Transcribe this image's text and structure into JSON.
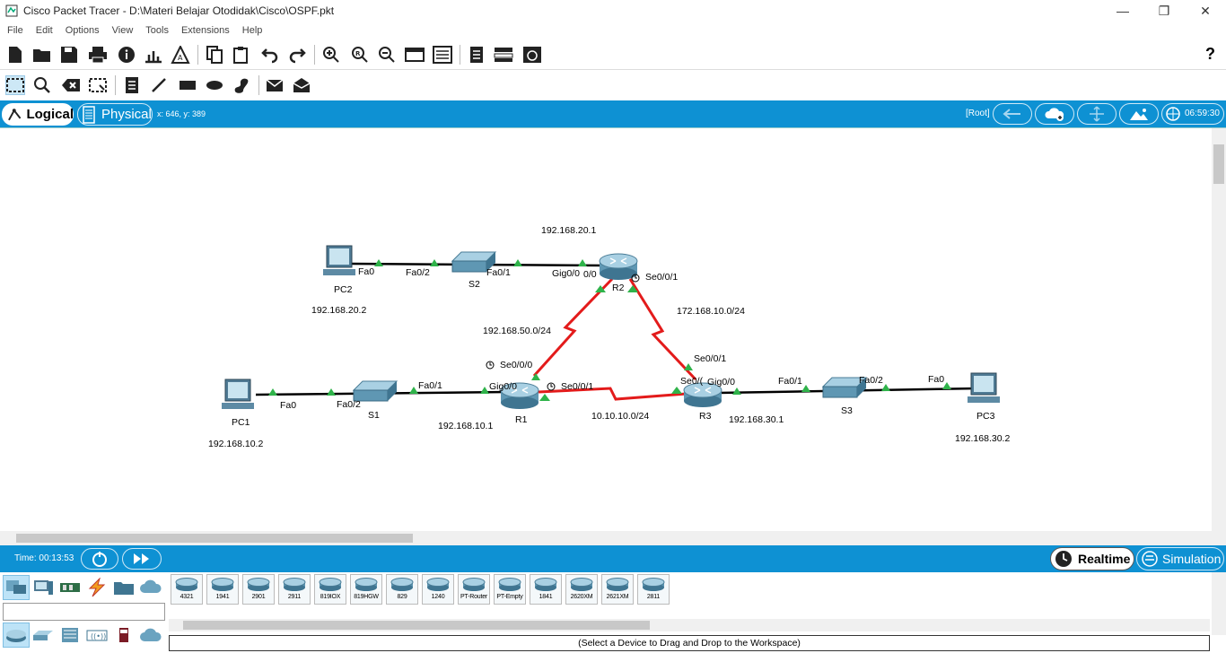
{
  "window": {
    "title": "Cisco Packet Tracer - D:\\Materi Belajar Otodidak\\Cisco\\OSPF.pkt"
  },
  "menu": [
    "File",
    "Edit",
    "Options",
    "View",
    "Tools",
    "Extensions",
    "Help"
  ],
  "topbar": {
    "logical_tab": "Logical",
    "physical_tab": "Physical",
    "coords": "x: 646, y: 389",
    "root": "[Root]",
    "clock": "06:59:30"
  },
  "topology": {
    "devices": {
      "pc2": {
        "name": "PC2",
        "ip": "192.168.20.2"
      },
      "s2": {
        "name": "S2"
      },
      "r2": {
        "name": "R2",
        "ip": "192.168.20.1"
      },
      "pc1": {
        "name": "PC1",
        "ip": "192.168.10.2"
      },
      "s1": {
        "name": "S1"
      },
      "r1": {
        "name": "R1",
        "ip": "192.168.10.1"
      },
      "r3": {
        "name": "R3",
        "ip": "192.168.30.1"
      },
      "s3": {
        "name": "S3"
      },
      "pc3": {
        "name": "PC3",
        "ip": "192.168.30.2"
      }
    },
    "ports": {
      "pc2_fa0": "Fa0",
      "s2_fa02": "Fa0/2",
      "s2_fa01": "Fa0/1",
      "r2_gig": "Gig0/0",
      "r2_gig_b": "0/0",
      "r2_se001": "Se0/0/1",
      "r1_se000": "Se0/0/0",
      "r1_se001": "Se0/0/1",
      "r1_gig": "Gig0/0",
      "pc1_fa0": "Fa0",
      "s1_fa02": "Fa0/2",
      "s1_fa01": "Fa0/1",
      "r3_se001": "Se0/0/1",
      "r3_se0": "Se0/(",
      "r3_gig": "Gig0/0",
      "s3_fa01": "Fa0/1",
      "s3_fa02": "Fa0/2",
      "pc3_fa0": "Fa0"
    },
    "networks": {
      "r1_r2": "192.168.50.0/24",
      "r2_r3": "172.168.10.0/24",
      "r1_r3": "10.10.10.0/24"
    }
  },
  "sim": {
    "time": "Time: 00:13:53",
    "realtime": "Realtime",
    "simulation": "Simulation"
  },
  "devices_panel": {
    "models": [
      "4321",
      "1941",
      "2901",
      "2911",
      "819IOX",
      "819HGW",
      "829",
      "1240",
      "PT-Router",
      "PT-Empty",
      "1841",
      "2620XM",
      "2621XM",
      "2811"
    ],
    "status": "(Select a Device to Drag and Drop to the Workspace)"
  }
}
